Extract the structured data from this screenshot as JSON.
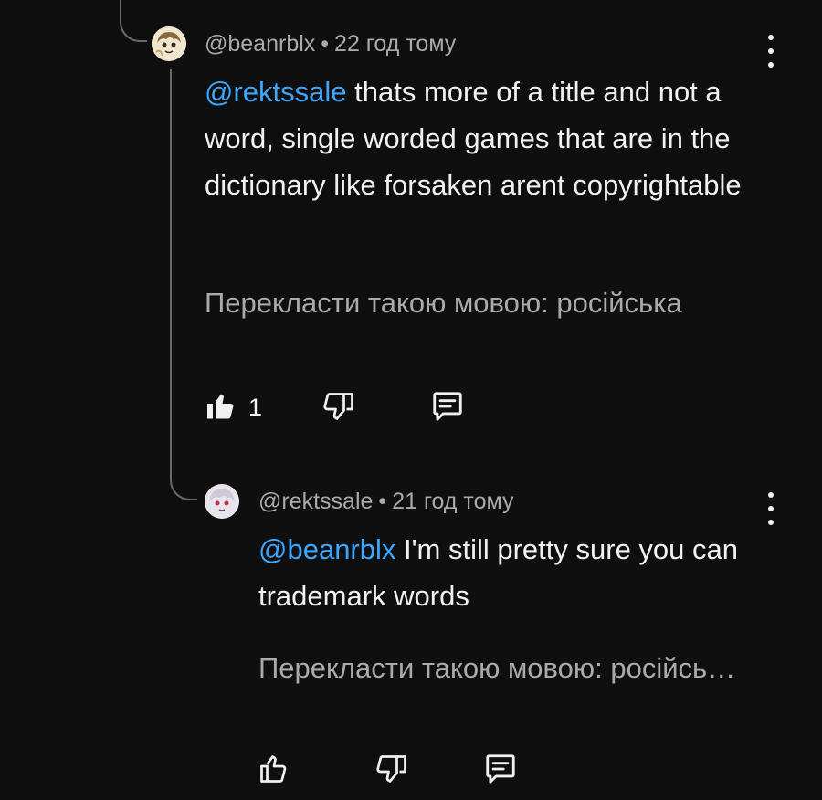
{
  "comments": [
    {
      "author": "@beanrblx",
      "separator": "•",
      "time": "22 год тому",
      "mention": "@rektssale",
      "text": " thats more of a title and not a word, single worded games that are in the dictionary like forsaken arent copyrightable",
      "translate": "Перекласти такою мовою: російська",
      "likes": "1",
      "liked": true,
      "avatar_icon": "anime-avatar-icon"
    },
    {
      "author": "@rektssale",
      "separator": "•",
      "time": "21 год тому",
      "mention": "@beanrblx",
      "text": " I'm still pretty sure you can trademark words",
      "translate": "Перекласти такою мовою: російсь…",
      "likes": "",
      "liked": false,
      "avatar_icon": "anime-avatar-icon"
    }
  ],
  "icons": {
    "like_filled": "thumbs-up-filled-icon",
    "like_outline": "thumbs-up-outline-icon",
    "dislike": "thumbs-down-icon",
    "reply": "reply-comment-icon",
    "more": "more-vertical-icon"
  },
  "colors": {
    "background": "#0f0f0f",
    "text": "#f1f1f1",
    "secondary": "#aaaaaa",
    "mention": "#3ea6ff",
    "thread_line": "#6b6b6b"
  }
}
